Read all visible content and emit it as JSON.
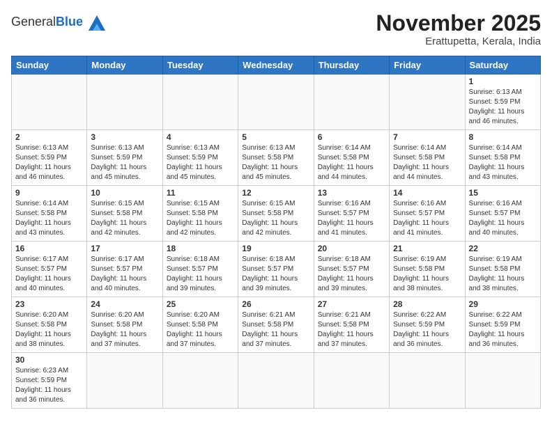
{
  "header": {
    "logo_general": "General",
    "logo_blue": "Blue",
    "month_title": "November 2025",
    "subtitle": "Erattupetta, Kerala, India"
  },
  "weekdays": [
    "Sunday",
    "Monday",
    "Tuesday",
    "Wednesday",
    "Thursday",
    "Friday",
    "Saturday"
  ],
  "weeks": [
    [
      {
        "day": "",
        "content": ""
      },
      {
        "day": "",
        "content": ""
      },
      {
        "day": "",
        "content": ""
      },
      {
        "day": "",
        "content": ""
      },
      {
        "day": "",
        "content": ""
      },
      {
        "day": "",
        "content": ""
      },
      {
        "day": "1",
        "content": "Sunrise: 6:13 AM\nSunset: 5:59 PM\nDaylight: 11 hours\nand 46 minutes."
      }
    ],
    [
      {
        "day": "2",
        "content": "Sunrise: 6:13 AM\nSunset: 5:59 PM\nDaylight: 11 hours\nand 46 minutes."
      },
      {
        "day": "3",
        "content": "Sunrise: 6:13 AM\nSunset: 5:59 PM\nDaylight: 11 hours\nand 45 minutes."
      },
      {
        "day": "4",
        "content": "Sunrise: 6:13 AM\nSunset: 5:59 PM\nDaylight: 11 hours\nand 45 minutes."
      },
      {
        "day": "5",
        "content": "Sunrise: 6:13 AM\nSunset: 5:58 PM\nDaylight: 11 hours\nand 45 minutes."
      },
      {
        "day": "6",
        "content": "Sunrise: 6:14 AM\nSunset: 5:58 PM\nDaylight: 11 hours\nand 44 minutes."
      },
      {
        "day": "7",
        "content": "Sunrise: 6:14 AM\nSunset: 5:58 PM\nDaylight: 11 hours\nand 44 minutes."
      },
      {
        "day": "8",
        "content": "Sunrise: 6:14 AM\nSunset: 5:58 PM\nDaylight: 11 hours\nand 43 minutes."
      }
    ],
    [
      {
        "day": "9",
        "content": "Sunrise: 6:14 AM\nSunset: 5:58 PM\nDaylight: 11 hours\nand 43 minutes."
      },
      {
        "day": "10",
        "content": "Sunrise: 6:15 AM\nSunset: 5:58 PM\nDaylight: 11 hours\nand 42 minutes."
      },
      {
        "day": "11",
        "content": "Sunrise: 6:15 AM\nSunset: 5:58 PM\nDaylight: 11 hours\nand 42 minutes."
      },
      {
        "day": "12",
        "content": "Sunrise: 6:15 AM\nSunset: 5:58 PM\nDaylight: 11 hours\nand 42 minutes."
      },
      {
        "day": "13",
        "content": "Sunrise: 6:16 AM\nSunset: 5:57 PM\nDaylight: 11 hours\nand 41 minutes."
      },
      {
        "day": "14",
        "content": "Sunrise: 6:16 AM\nSunset: 5:57 PM\nDaylight: 11 hours\nand 41 minutes."
      },
      {
        "day": "15",
        "content": "Sunrise: 6:16 AM\nSunset: 5:57 PM\nDaylight: 11 hours\nand 40 minutes."
      }
    ],
    [
      {
        "day": "16",
        "content": "Sunrise: 6:17 AM\nSunset: 5:57 PM\nDaylight: 11 hours\nand 40 minutes."
      },
      {
        "day": "17",
        "content": "Sunrise: 6:17 AM\nSunset: 5:57 PM\nDaylight: 11 hours\nand 40 minutes."
      },
      {
        "day": "18",
        "content": "Sunrise: 6:18 AM\nSunset: 5:57 PM\nDaylight: 11 hours\nand 39 minutes."
      },
      {
        "day": "19",
        "content": "Sunrise: 6:18 AM\nSunset: 5:57 PM\nDaylight: 11 hours\nand 39 minutes."
      },
      {
        "day": "20",
        "content": "Sunrise: 6:18 AM\nSunset: 5:57 PM\nDaylight: 11 hours\nand 39 minutes."
      },
      {
        "day": "21",
        "content": "Sunrise: 6:19 AM\nSunset: 5:58 PM\nDaylight: 11 hours\nand 38 minutes."
      },
      {
        "day": "22",
        "content": "Sunrise: 6:19 AM\nSunset: 5:58 PM\nDaylight: 11 hours\nand 38 minutes."
      }
    ],
    [
      {
        "day": "23",
        "content": "Sunrise: 6:20 AM\nSunset: 5:58 PM\nDaylight: 11 hours\nand 38 minutes."
      },
      {
        "day": "24",
        "content": "Sunrise: 6:20 AM\nSunset: 5:58 PM\nDaylight: 11 hours\nand 37 minutes."
      },
      {
        "day": "25",
        "content": "Sunrise: 6:20 AM\nSunset: 5:58 PM\nDaylight: 11 hours\nand 37 minutes."
      },
      {
        "day": "26",
        "content": "Sunrise: 6:21 AM\nSunset: 5:58 PM\nDaylight: 11 hours\nand 37 minutes."
      },
      {
        "day": "27",
        "content": "Sunrise: 6:21 AM\nSunset: 5:58 PM\nDaylight: 11 hours\nand 37 minutes."
      },
      {
        "day": "28",
        "content": "Sunrise: 6:22 AM\nSunset: 5:59 PM\nDaylight: 11 hours\nand 36 minutes."
      },
      {
        "day": "29",
        "content": "Sunrise: 6:22 AM\nSunset: 5:59 PM\nDaylight: 11 hours\nand 36 minutes."
      }
    ],
    [
      {
        "day": "30",
        "content": "Sunrise: 6:23 AM\nSunset: 5:59 PM\nDaylight: 11 hours\nand 36 minutes."
      },
      {
        "day": "",
        "content": ""
      },
      {
        "day": "",
        "content": ""
      },
      {
        "day": "",
        "content": ""
      },
      {
        "day": "",
        "content": ""
      },
      {
        "day": "",
        "content": ""
      },
      {
        "day": "",
        "content": ""
      }
    ]
  ]
}
